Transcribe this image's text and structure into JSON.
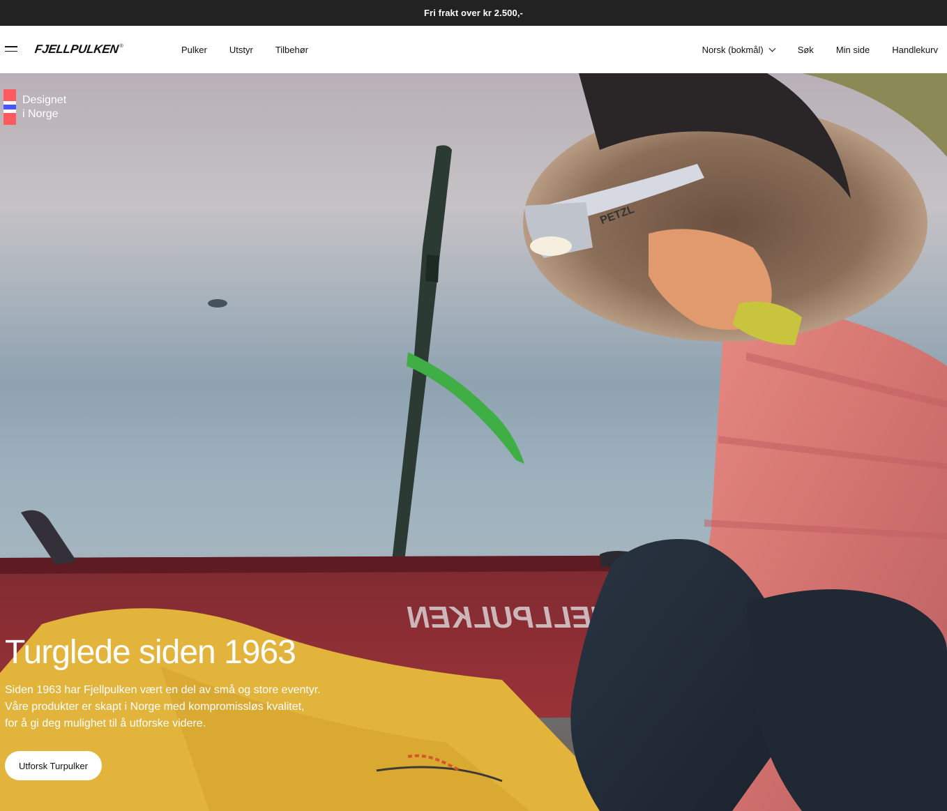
{
  "announcement": {
    "text": "Fri frakt over kr 2.500,-"
  },
  "header": {
    "logo": {
      "word": "FJELLPULKEN",
      "mark": "®"
    },
    "nav": [
      "Pulker",
      "Utstyr",
      "Tilbehør"
    ],
    "language": "Norsk (bokmål)",
    "search": "Søk",
    "account": "Min side",
    "cart": "Handlekurv"
  },
  "hero": {
    "badge": {
      "line1": "Designet",
      "line2": "i Norge"
    },
    "title": "Turglede siden 1963",
    "body_lines": [
      "Siden 1963 har Fjellpulken vært en del av små og store eventyr.",
      "Våre produkter er skapt i Norge med kompromissløs kvalitet,",
      "for å gi deg mulighet til å utforske videre."
    ],
    "cta": "Utforsk Turpulker",
    "sled_text": "FJELLPULKEN",
    "headlamp_text": "PETZL"
  },
  "colors": {
    "topbar": "#222222",
    "flag_red": "#ff5a5f",
    "flag_blue": "#4a55ff",
    "jacket_pink": "#d97a76",
    "sled_red": "#8e2c33",
    "bag_yellow": "#e0b33b"
  }
}
